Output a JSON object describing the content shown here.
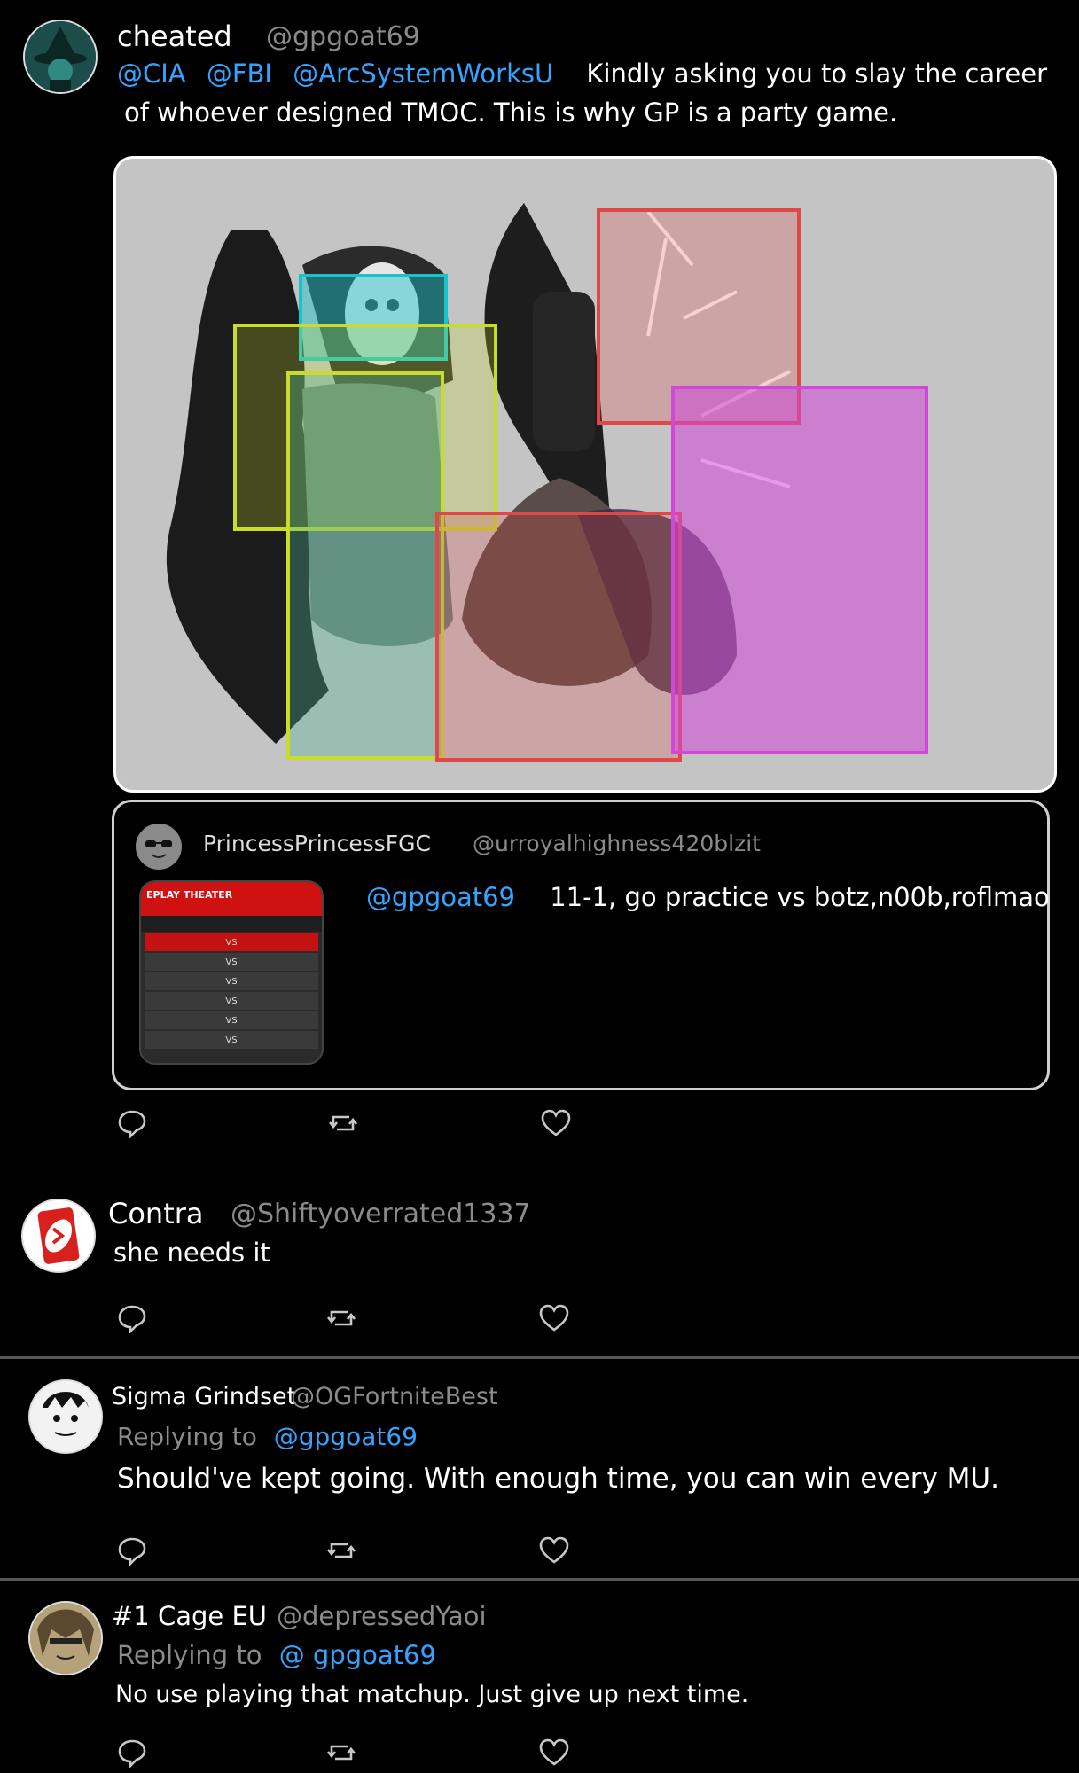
{
  "posts": [
    {
      "name": "cheated",
      "handle": "@gpgoat69",
      "mentions": [
        "@CIA",
        "@FBI",
        "@ArcSystemWorksU"
      ],
      "text_line1": "Kindly asking you to slay the career",
      "text_line2": "of whoever designed TMOC. This is why GP is a party game.",
      "quote": {
        "name": "PrincessPrincessFGC",
        "handle": "@urroyalhighness420blzit",
        "mention": "@gpgoat69",
        "text": "11-1, go practice vs botz,n00b,roflmao",
        "replay_title": "EPLAY THEATER",
        "replay_vs": "VS"
      }
    },
    {
      "name": "Contra",
      "handle": "@Shiftyoverrated1337",
      "text": "she needs it"
    },
    {
      "name": "Sigma Grindset",
      "handle": "@OGFortniteBest",
      "replying_label": "Replying to",
      "replying_to": "@gpgoat69",
      "text": "Should've kept going. With enough time, you can win every MU."
    },
    {
      "name": "#1 Cage EU",
      "handle": "@depressedYaoi",
      "replying_label": "Replying to",
      "replying_to": "@ gpgoat69",
      "text": "No use playing that matchup. Just give up next time."
    }
  ],
  "icons": {
    "reply": "reply-bubble-icon",
    "retweet": "retweet-icon",
    "like": "heart-icon"
  },
  "colors": {
    "link": "#35a4ff",
    "hitbox_cyan": "#18c4cc",
    "hitbox_lime": "#c8dc2c",
    "hitbox_red": "#e04848",
    "hitbox_magenta": "#d048d8"
  }
}
